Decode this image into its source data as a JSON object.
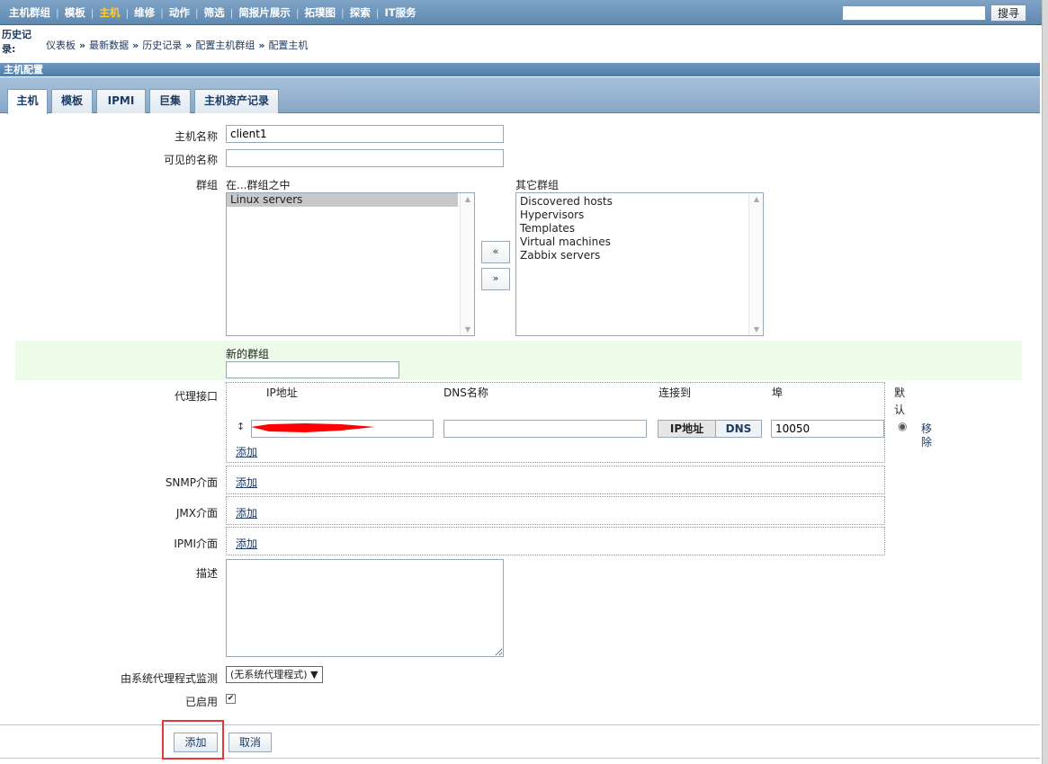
{
  "nav": {
    "items": [
      {
        "label": "主机群组",
        "active": false
      },
      {
        "label": "模板",
        "active": false
      },
      {
        "label": "主机",
        "active": true
      },
      {
        "label": "维修",
        "active": false
      },
      {
        "label": "动作",
        "active": false
      },
      {
        "label": "筛选",
        "active": false
      },
      {
        "label": "简报片展示",
        "active": false
      },
      {
        "label": "拓璞图",
        "active": false
      },
      {
        "label": "探索",
        "active": false
      },
      {
        "label": "IT服务",
        "active": false
      }
    ],
    "search_value": "",
    "search_button": "搜寻"
  },
  "history": {
    "label": "历史记录:",
    "crumbs": [
      "仪表板",
      "最新数据",
      "历史记录",
      "配置主机群组",
      "配置主机"
    ]
  },
  "section_title": "主机配置",
  "tabs": [
    "主机",
    "模板",
    "IPMI",
    "巨集",
    "主机资产记录"
  ],
  "form": {
    "host_name_label": "主机名称",
    "host_name_value": "client1",
    "visible_name_label": "可见的名称",
    "visible_name_value": "",
    "groups_label": "群组",
    "in_groups_label": "在...群组之中",
    "in_groups": [
      "Linux servers"
    ],
    "other_groups_label": "其它群组",
    "other_groups": [
      "Discovered hosts",
      "Hypervisors",
      "Templates",
      "Virtual machines",
      "Zabbix servers"
    ],
    "move_left": "«",
    "move_right": "»",
    "new_group_label": "新的群组",
    "new_group_value": "",
    "agent_iface_label": "代理接口",
    "col_ip": "IP地址",
    "col_dns": "DNS名称",
    "col_connect": "连接到",
    "col_port": "埠",
    "col_default": "默认",
    "dns_value": "",
    "conn_ip": "IP地址",
    "conn_dns": "DNS",
    "port_value": "10050",
    "remove_label": "移除",
    "add_label": "添加",
    "snmp_label": "SNMP介面",
    "jmx_label": "JMX介面",
    "ipmi_label": "IPMI介面",
    "description_label": "描述",
    "description_value": "",
    "proxy_label": "由系统代理程式监测",
    "proxy_value": "(无系统代理程式)",
    "enabled_label": "已启用",
    "enabled": true
  },
  "buttons": {
    "add": "添加",
    "cancel": "取消"
  }
}
